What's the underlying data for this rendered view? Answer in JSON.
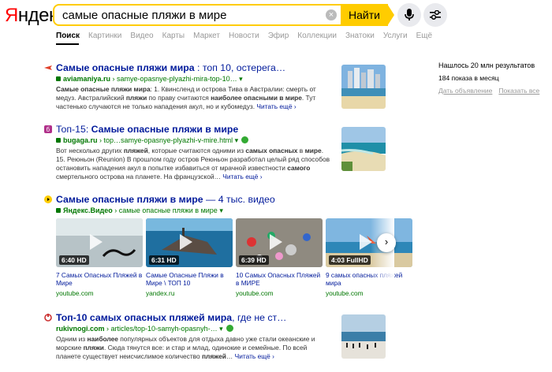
{
  "logo": {
    "first": "Я",
    "rest": "ндекс"
  },
  "search": {
    "query": "самые опасные пляжи в мире",
    "clear": "×",
    "button": "Найти"
  },
  "tabs": [
    "Поиск",
    "Картинки",
    "Видео",
    "Карты",
    "Маркет",
    "Новости",
    "Эфир",
    "Коллекции",
    "Знатоки",
    "Услуги",
    "Ещё"
  ],
  "stats": {
    "found": "Нашлось 20 млн результатов",
    "shows": "184 показа в месяц",
    "link1": "Дать объявление",
    "link2": "Показать все"
  },
  "results": [
    {
      "title_bold": "Самые опасные пляжи мира",
      "title_rest": " : топ 10, остерега…",
      "domain": "aviamaniya.ru",
      "path": " › samye-opasnye-plyazhi-mira-top-10…",
      "snippet_a": "Самые опасные пляжи мира",
      "snippet_b": ": 1. Квинсленд и острова Тива в Австралии: смерть от медуз. Австралийский ",
      "snippet_c": "пляжи",
      "snippet_d": " по праву считаются ",
      "snippet_e": "наиболее опасными в мире",
      "snippet_f": ". Тут частенько случаются не только нападения акул, но и кубомедуз. ",
      "more": "Читать ещё ›"
    },
    {
      "title_rest": "Топ-15: ",
      "title_bold": "Самые опасные пляжи в мире",
      "domain": "bugaga.ru",
      "path": " › top…samye-opasnye-plyazhi-v-mire.html",
      "snippet_a": "Вот несколько других ",
      "snippet_b": "пляжей",
      "snippet_c": ", которые считаются одними из ",
      "snippet_d": "самых опасных",
      "snippet_e": " в ",
      "snippet_f": "мире",
      "snippet_g": ". 15. Реюньон (Reunion) В прошлом году остров Реюньон разработал целый ряд способов остановить нападения акул в попытке избавиться от мрачной известности ",
      "snippet_h": "самого",
      "snippet_i": " смертельного острова на планете. На французской… ",
      "more": "Читать ещё ›"
    },
    {
      "title_bold": "Самые опасные пляжи в мире",
      "title_rest": " — 4 тыс. видео",
      "domain": "Яндекс.Видео",
      "path": " › самые опасные пляжи в мире"
    },
    {
      "title_bold": "Топ-10 самых опасных пляжей мира",
      "title_rest": ", где не ст…",
      "domain": "rukivnogi.com",
      "path": " › articles/top-10-samyh-opasnyh-…",
      "snippet_a": "Одним из ",
      "snippet_b": "наиболее",
      "snippet_c": " популярных объектов для отдыха давно уже стали океанские и морские ",
      "snippet_d": "пляжи",
      "snippet_e": ". Сюда тянутся все: и стар и млад, одинокие и семейные. По всей планете существует неисчислимое количество ",
      "snippet_f": "пляжей",
      "snippet_g": "… ",
      "more": "Читать ещё ›"
    }
  ],
  "videos": [
    {
      "duration": "6:40 HD",
      "title": "7 Самых Опасных Пляжей в Мире",
      "source": "youtube.com"
    },
    {
      "duration": "6:31 HD",
      "title": "Самые Опасные Пляжи в Мире \\ ТОП 10",
      "source": "yandex.ru"
    },
    {
      "duration": "6:39 HD",
      "title": "10 Самых Опасных Пляжей в МИРЕ",
      "source": "youtube.com"
    },
    {
      "duration": "4:03 FullHD",
      "title": "9 самых опасных пляжей мира",
      "source": "youtube.com"
    }
  ],
  "next": "›",
  "colors": {
    "link": "#001a9b",
    "url": "#007700",
    "accent": "#ffcc00",
    "logo_red": "#ff0000"
  }
}
